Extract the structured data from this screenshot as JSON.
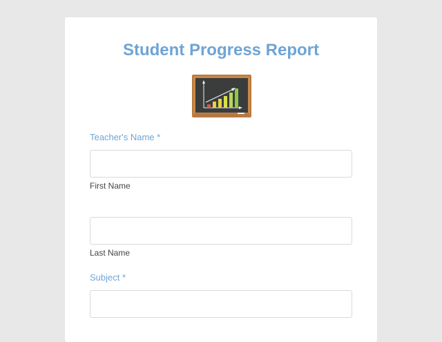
{
  "form": {
    "title": "Student Progress Report",
    "logo_icon": "chalkboard-chart-icon",
    "fields": {
      "teacher_name": {
        "label": "Teacher's Name",
        "required_mark": "*",
        "first_name": {
          "value": "",
          "placeholder": "",
          "sublabel": "First Name"
        },
        "last_name": {
          "value": "",
          "placeholder": "",
          "sublabel": "Last Name"
        }
      },
      "subject": {
        "label": "Subject",
        "required_mark": "*",
        "value": "",
        "placeholder": ""
      }
    }
  },
  "colors": {
    "accent": "#6fa4d4",
    "page_background": "#e8e8e8",
    "card_background": "#ffffff",
    "input_border": "#d5d9dd"
  }
}
